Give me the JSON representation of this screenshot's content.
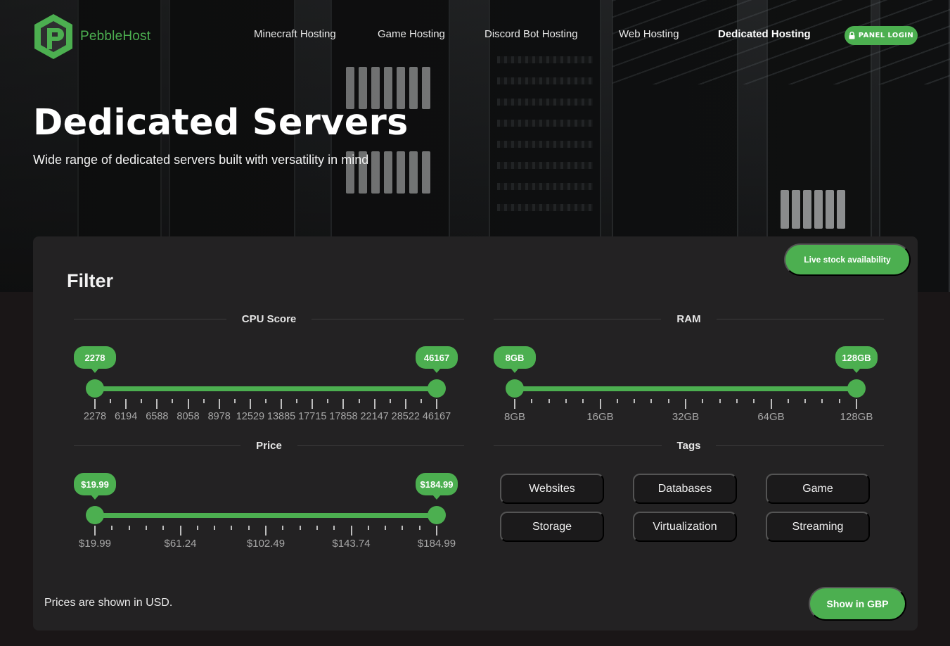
{
  "brand": {
    "name": "PebbleHost"
  },
  "nav": {
    "items": [
      {
        "label": "Minecraft Hosting"
      },
      {
        "label": "Game Hosting"
      },
      {
        "label": "Discord Bot Hosting"
      },
      {
        "label": "Web Hosting"
      },
      {
        "label": "Dedicated Hosting",
        "active": true
      }
    ],
    "panel_login": "PANEL LOGIN",
    "panel_login_icon": "lock-icon"
  },
  "hero": {
    "title": "Dedicated Servers",
    "subtitle": "Wide range of dedicated servers built with versatility in mind"
  },
  "filter": {
    "heading": "Filter",
    "live_stock_button": "Live stock availability",
    "cpu": {
      "title": "CPU Score",
      "min_label": "2278",
      "max_label": "46167",
      "ticks": [
        "2278",
        "6194",
        "6588",
        "8058",
        "8978",
        "12529",
        "13885",
        "17715",
        "17858",
        "22147",
        "28522",
        "46167"
      ]
    },
    "ram": {
      "title": "RAM",
      "min_label": "8GB",
      "max_label": "128GB",
      "ticks": [
        "8GB",
        "16GB",
        "32GB",
        "64GB",
        "128GB"
      ]
    },
    "price": {
      "title": "Price",
      "min_label": "$19.99",
      "max_label": "$184.99",
      "ticks": [
        "$19.99",
        "$61.24",
        "$102.49",
        "$143.74",
        "$184.99"
      ]
    },
    "tags": {
      "title": "Tags",
      "items": [
        "Websites",
        "Databases",
        "Game",
        "Storage",
        "Virtualization",
        "Streaming"
      ]
    },
    "prices_note": "Prices are shown in USD.",
    "show_gbp_button": "Show in GBP"
  },
  "colors": {
    "accent": "#4caf50",
    "panel_bg": "#232223",
    "page_bg": "#1a1617",
    "tag_bg": "#1b1a1b"
  }
}
